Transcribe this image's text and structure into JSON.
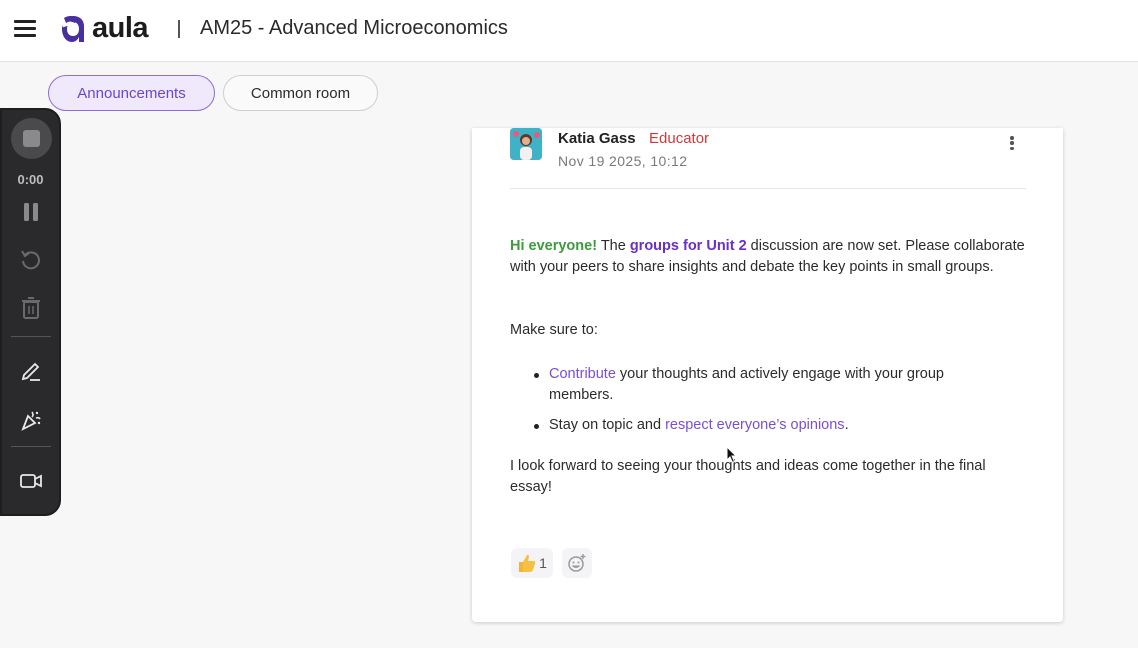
{
  "header": {
    "logo_text": "aula",
    "course_title": "AM25 - Advanced Microeconomics"
  },
  "tabs": [
    {
      "label": "Announcements",
      "active": true
    },
    {
      "label": "Common room",
      "active": false
    }
  ],
  "recorder": {
    "time": "0:00",
    "icons": [
      "stop-icon",
      "pause-icon",
      "restart-icon",
      "trash-icon",
      "pen-icon",
      "confetti-icon",
      "camera-icon"
    ]
  },
  "post": {
    "author": "Katia Gass",
    "role": "Educator",
    "timestamp": "Nov 19 2025, 10:12",
    "p1": {
      "greeting": "Hi everyone!",
      "t1": " The ",
      "link1": "groups for Unit 2",
      "t2": " discussion are now set. Please collaborate with your peers to share insights and debate the key points in small groups."
    },
    "p2": "Make sure to:",
    "bullet1": {
      "link": "Contribute",
      "text": " your thoughts and actively engage with your group members."
    },
    "bullet2": {
      "text1": "Stay on topic and ",
      "link": "respect everyone’s opinions",
      "text2": "."
    },
    "p3": "I look forward to seeing your thoughts and ideas come together in the final essay!",
    "reactions": {
      "like_count": "1"
    }
  },
  "colors": {
    "accent": "#6b46c9",
    "role": "#d23a3a",
    "greeting": "#3d9a3d",
    "recorder_bg": "#2a2a2c"
  }
}
